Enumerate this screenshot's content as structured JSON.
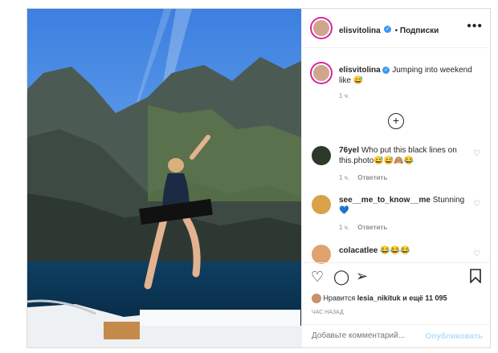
{
  "post": {
    "username": "elisvitolina",
    "follow_label": "Подписки",
    "caption": "Jumping into weekend like 😅",
    "caption_time": "1 ч."
  },
  "comments": [
    {
      "user": "76yel",
      "text": "Who put this black lines on this.photo😅😅🙈😂",
      "time": "1 ч.",
      "reply": "Ответить"
    },
    {
      "user": "see__me_to_know__me",
      "text": "Stunning 💙",
      "time": "1 ч.",
      "reply": "Ответить"
    },
    {
      "user": "colacatlee",
      "text": "😂😂😂"
    }
  ],
  "likes": {
    "prefix": "Нравится",
    "user": "lesia_nikituk",
    "suffix": "и ещё 11 095"
  },
  "posted_ago": "ЧАС НАЗАД",
  "comment_box": {
    "placeholder": "Добавьте комментарий...",
    "publish_label": "Опубликовать"
  },
  "colors": {
    "verified": "#3897f0",
    "publish": "#b2dffc",
    "link_text": "#262626"
  }
}
